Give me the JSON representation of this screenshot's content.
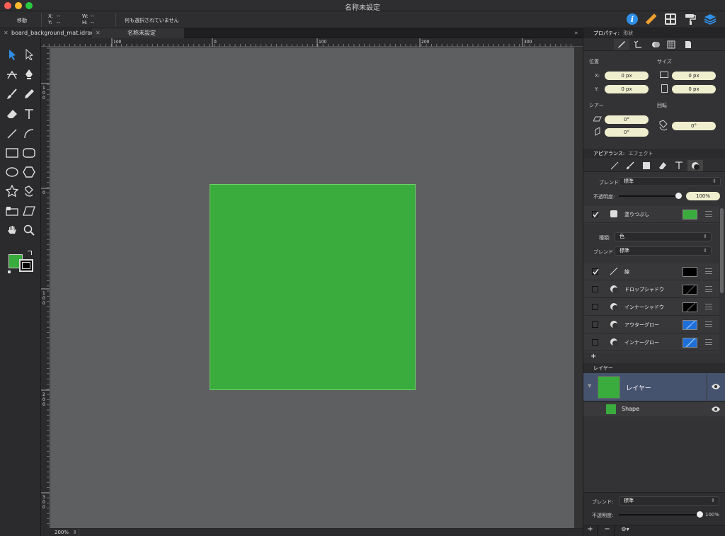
{
  "window": {
    "title": "名称未設定"
  },
  "toolbar": {
    "move_label": "移動",
    "x_label": "X:",
    "x_value": "--",
    "y_label": "Y:",
    "y_value": "--",
    "w_label": "W:",
    "w_value": "--",
    "h_label": "H:",
    "h_value": "--",
    "selection_status": "何も選択されていません"
  },
  "tabs": [
    {
      "label": "board_background_mat.idraw",
      "close": "✕"
    },
    {
      "label": "名称未設定",
      "close": "✕"
    }
  ],
  "tabbar_overflow": "»",
  "rulers": {
    "h_ticks": [
      "100",
      "0",
      "100",
      "200",
      "300"
    ],
    "v_ticks": [
      "1 0 0",
      "0",
      "1 0 0",
      "2 0 0",
      "3 0 0"
    ]
  },
  "zoom": {
    "value": "200%",
    "stepper": "⇕"
  },
  "shape": {
    "fill": "#3aab3d"
  },
  "colors": {
    "fill_swatch": "#3aab3d",
    "stroke_swatch": "#000000"
  },
  "properties": {
    "header": "プロパティ:",
    "header_sub": "形状",
    "position_label": "位置",
    "size_label": "サイズ",
    "x_label": "X:",
    "x_value": "0 px",
    "y_label": "Y:",
    "y_value": "0 px",
    "width_value": "0 px",
    "height_value": "0 px",
    "shear_label": "シアー",
    "rotation_label": "回転",
    "shear_x_value": "0°",
    "shear_y_value": "0°",
    "rotation_value": "0°"
  },
  "appearance": {
    "header": "アピアランス:",
    "header_sub": "エフェクト",
    "blend_label": "ブレンド",
    "blend_value": "標準",
    "opacity_label": "不透明度:",
    "opacity_value": "100%",
    "fill": {
      "label": "塗りつぶし",
      "color": "#3aab3d",
      "kind_label": "種類:",
      "kind_value": "色",
      "blend_label": "ブレンド",
      "blend_value": "標準"
    },
    "stroke": {
      "label": "線",
      "color": "#000000"
    },
    "effects": [
      {
        "label": "ドロップシャドウ"
      },
      {
        "label": "インナーシャドウ"
      },
      {
        "label": "アウターグロー"
      },
      {
        "label": "インナーグロー"
      }
    ],
    "add_label": "+"
  },
  "layers": {
    "header": "レイヤー",
    "layer_name": "レイヤー",
    "shape_name": "Shape",
    "layer_color": "#3aab3d",
    "blend_label": "ブレンド:",
    "blend_value": "標準",
    "opacity_label": "不透明度:",
    "opacity_value": "100%",
    "add_label": "+",
    "remove_label": "−",
    "gear_label": "⚙▾"
  }
}
